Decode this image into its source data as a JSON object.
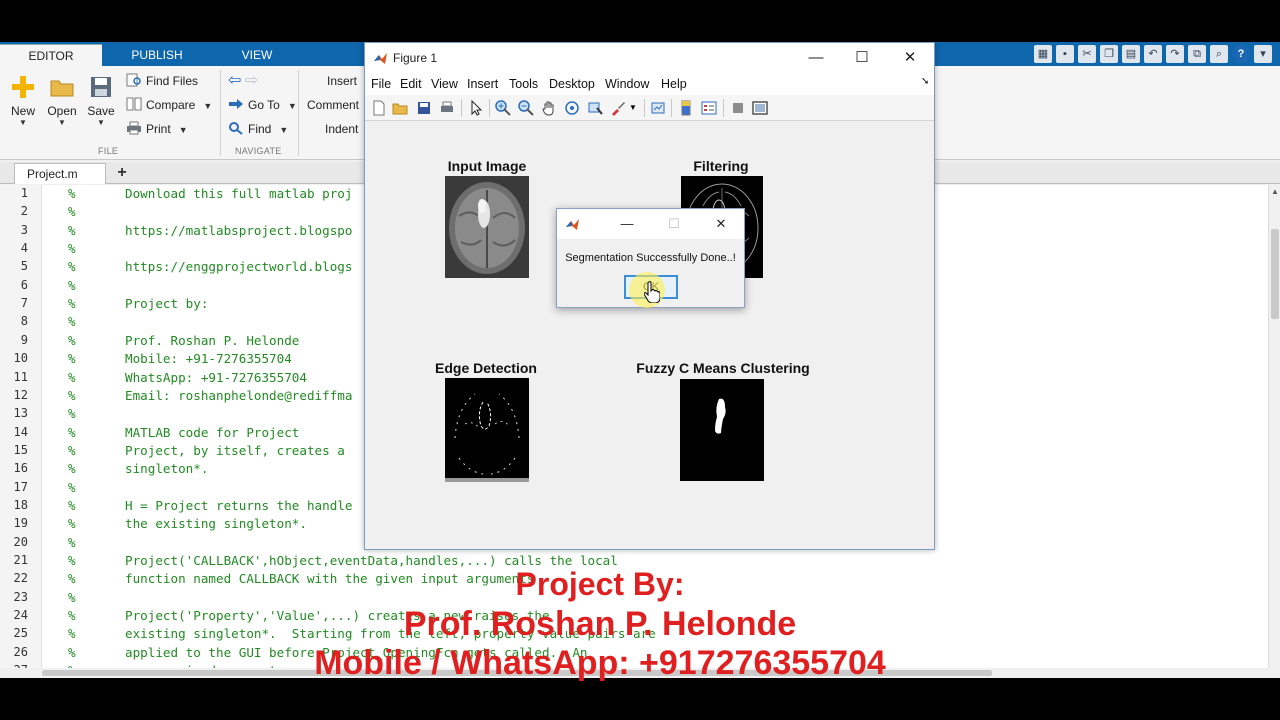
{
  "ribbon": {
    "tabs": [
      "EDITOR",
      "PUBLISH",
      "VIEW"
    ],
    "file_group": {
      "label": "FILE",
      "new": "New",
      "open": "Open",
      "save": "Save",
      "find_files": "Find Files",
      "compare": "Compare",
      "print": "Print"
    },
    "navigate_group": {
      "label": "NAVIGATE",
      "go_to": "Go To",
      "find": "Find"
    },
    "edit_group": {
      "insert": "Insert",
      "comment": "Comment",
      "indent": "Indent"
    }
  },
  "editor": {
    "tab_label": "Project.m",
    "lines": [
      {
        "n": "1",
        "t": "Download this full matlab proj"
      },
      {
        "n": "2",
        "t": ""
      },
      {
        "n": "3",
        "t": "https://matlabsproject.blogspo"
      },
      {
        "n": "4",
        "t": ""
      },
      {
        "n": "5",
        "t": "https://enggprojectworld.blogs"
      },
      {
        "n": "6",
        "t": ""
      },
      {
        "n": "7",
        "t": "Project by:"
      },
      {
        "n": "8",
        "t": ""
      },
      {
        "n": "9",
        "t": "Prof. Roshan P. Helonde"
      },
      {
        "n": "10",
        "t": "Mobile: +91-7276355704"
      },
      {
        "n": "11",
        "t": "WhatsApp: +91-7276355704"
      },
      {
        "n": "12",
        "t": "Email: roshanphelonde@rediffma"
      },
      {
        "n": "13",
        "t": ""
      },
      {
        "n": "14",
        "t": "MATLAB code for Project"
      },
      {
        "n": "15",
        "t": "Project, by itself, creates a"
      },
      {
        "n": "16",
        "t": "singleton*."
      },
      {
        "n": "17",
        "t": ""
      },
      {
        "n": "18",
        "t": "H = Project returns the handle"
      },
      {
        "n": "19",
        "t": "the existing singleton*."
      },
      {
        "n": "20",
        "t": ""
      },
      {
        "n": "21",
        "t": "Project('CALLBACK',hObject,eventData,handles,...) calls the local"
      },
      {
        "n": "22",
        "t": "function named CALLBACK with the given input arguments"
      },
      {
        "n": "23",
        "t": ""
      },
      {
        "n": "24",
        "t": "Project('Property','Value',...) creates a new raises the"
      },
      {
        "n": "25",
        "t": "existing singleton*.  Starting from the left, property value pairs are"
      },
      {
        "n": "26",
        "t": "applied to the GUI before Project_OpeningFcn gets called.  An"
      },
      {
        "n": "27",
        "t": "unrecognized property..."
      }
    ]
  },
  "figure": {
    "title": "Figure 1",
    "menu": [
      "File",
      "Edit",
      "View",
      "Insert",
      "Tools",
      "Desktop",
      "Window",
      "Help"
    ],
    "panels": {
      "input": "Input Image",
      "filtering": "Filtering",
      "edge": "Edge Detection",
      "fcm": "Fuzzy C Means Clustering"
    }
  },
  "dialog": {
    "message": "Segmentation Successfully Done..!",
    "ok_label": "OK"
  },
  "watermark": {
    "line1": "Project By:",
    "line2": "Prof. Roshan P. Helonde",
    "line3": "Mobile / WhatsApp: +917276355704"
  },
  "colors": {
    "ribbon_tab_bar": "#0e66ad",
    "comment_green": "#228b22",
    "watermark_red": "#e02020"
  }
}
